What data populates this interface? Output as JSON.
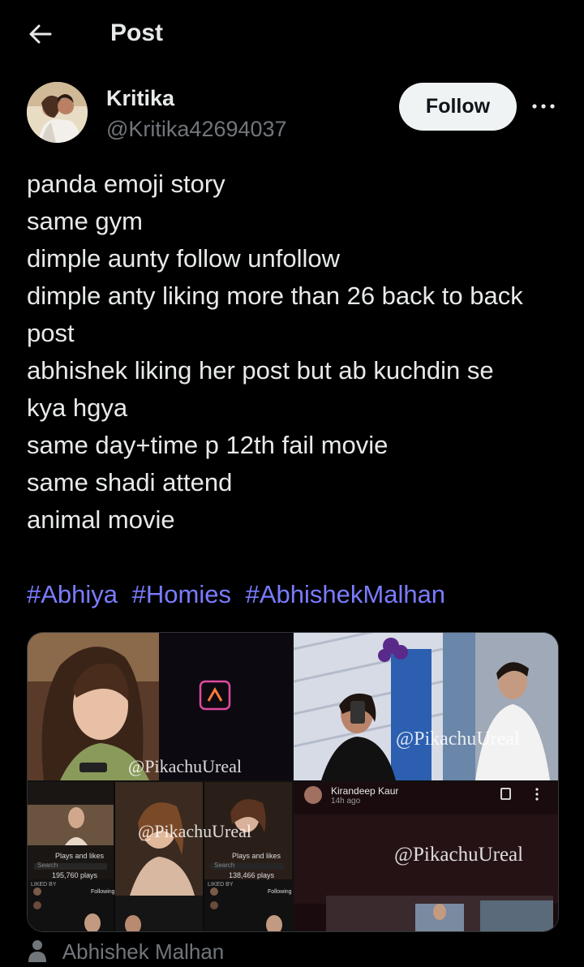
{
  "header": {
    "title": "Post"
  },
  "author": {
    "display_name": "Kritika",
    "handle": "@Kritika42694037",
    "follow_label": "Follow"
  },
  "post": {
    "lines": [
      "panda emoji story",
      "same gym",
      "dimple aunty follow unfollow",
      "dimple anty liking more than 26 back to back",
      "post",
      "abhishek liking her post but ab kuchdin se",
      "kya hgya",
      "same day+time p 12th fail movie",
      "same shadi attend",
      "animal movie"
    ],
    "hashtags": [
      "#Abhiya",
      "#Homies",
      "#AbhishekMalhan"
    ]
  },
  "media": {
    "watermark": "@PikachuUreal",
    "tile4_user": "Kirandeep Kaur",
    "tile4_time": "14h ago",
    "tile3_left_heading": "Plays and likes",
    "tile3_left_plays": "195,760 plays",
    "tile3_right_heading": "Plays and likes",
    "tile3_right_plays": "138,466 plays",
    "tile3_follow_label": "Following",
    "tile3_liked_by": "LIKED BY",
    "tile3_search": "Search"
  },
  "mentioned": {
    "name": "Abhishek Malhan"
  },
  "colors": {
    "background": "#000000",
    "text": "#e7e9ea",
    "muted": "#71767b",
    "hashtag": "#7a7cff",
    "follow_bg": "#eff3f4"
  }
}
